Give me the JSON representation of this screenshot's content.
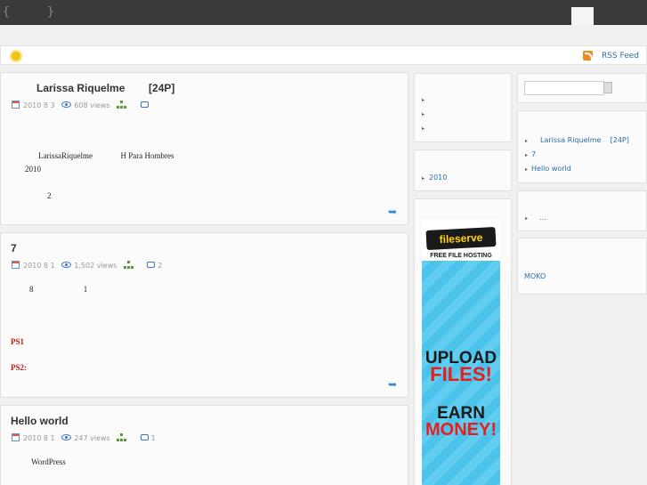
{
  "header": {
    "logo_left": "{",
    "logo_right": "}"
  },
  "subbar": {
    "rss_label": "RSS Feed"
  },
  "posts": [
    {
      "title": "Larissa Riquelme        [24P]",
      "date": "2010 8 3",
      "views": "608 views",
      "comments": "",
      "lines": [
        "LarissaRiquelme              H Para Hombres",
        "2010",
        "2"
      ]
    },
    {
      "title": "7",
      "date": "2010 8 1",
      "views": "1,502 views",
      "comments": "2",
      "lines": [
        "8                         1",
        "PS1",
        "PS2:"
      ]
    },
    {
      "title": "Hello world",
      "date": "2010 8 1",
      "views": "247 views",
      "comments": "1",
      "lines": [
        "WordPress"
      ]
    }
  ],
  "sidebar_mid": {
    "archive_item": "2010"
  },
  "ad": {
    "brand": "fileserve",
    "tagline": "FREE FILE HOSTING",
    "line1": "UPLOAD",
    "line2": "FILES!",
    "line3": "EARN",
    "line4": "MONEY!"
  },
  "sidebar_right": {
    "recent_posts": [
      "Larissa Riquelme    [24P]",
      "7",
      "Hello world"
    ],
    "comments_item": "...",
    "links_item": "MOKO"
  }
}
